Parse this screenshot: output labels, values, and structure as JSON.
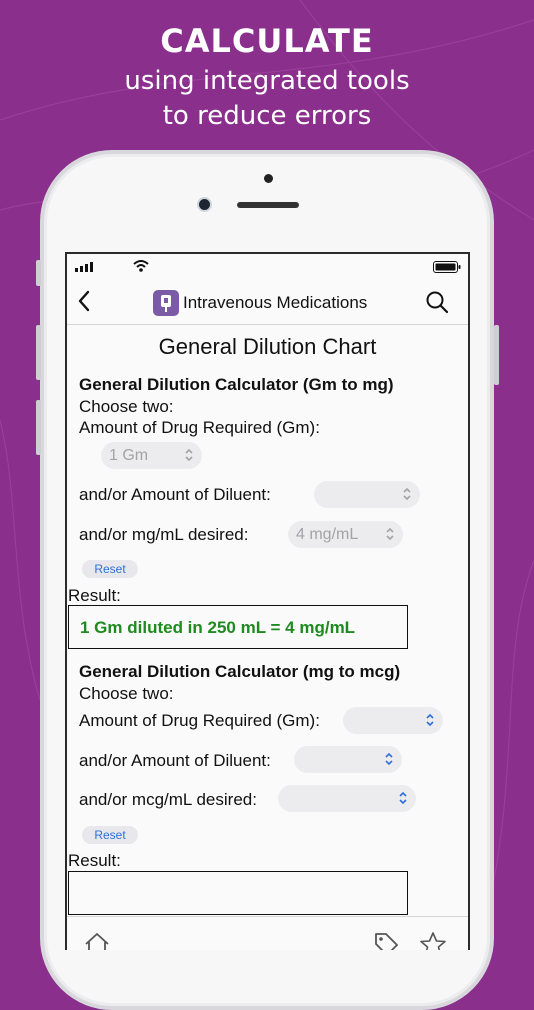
{
  "promo": {
    "headline": "CALCULATE",
    "subline1": "using integrated tools",
    "subline2": "to reduce errors",
    "bg_color": "#8a2f8c"
  },
  "nav": {
    "back_icon": "chevron-left-icon",
    "title": "Intravenous Medications",
    "app_icon": "iv-bag-icon",
    "search_icon": "search-icon"
  },
  "page": {
    "title": "General Dilution Chart"
  },
  "calc1": {
    "heading": "General Dilution Calculator (Gm to mg)",
    "choose": "Choose two:",
    "amount_label": "Amount of Drug Required (Gm):",
    "amount_value": "1 Gm",
    "diluent_label": "and/or Amount of Diluent:",
    "diluent_value": "",
    "desired_label": "and/or mg/mL desired:",
    "desired_value": "4 mg/mL",
    "reset_label": "Reset",
    "result_label": "Result:",
    "result_text": "1 Gm diluted in 250 mL = 4 mg/mL",
    "result_color": "#1f8a1f"
  },
  "calc2": {
    "heading": "General Dilution Calculator (mg to mcg)",
    "choose": "Choose two:",
    "amount_label": "Amount of Drug Required (Gm):",
    "amount_value": "",
    "diluent_label": "and/or Amount of Diluent:",
    "diluent_value": "",
    "desired_label": "and/or mcg/mL desired:",
    "desired_value": "",
    "reset_label": "Reset",
    "result_label": "Result:",
    "result_text": ""
  },
  "tabbar": {
    "icons": [
      "home-icon",
      "tag-icon",
      "star-icon"
    ]
  }
}
